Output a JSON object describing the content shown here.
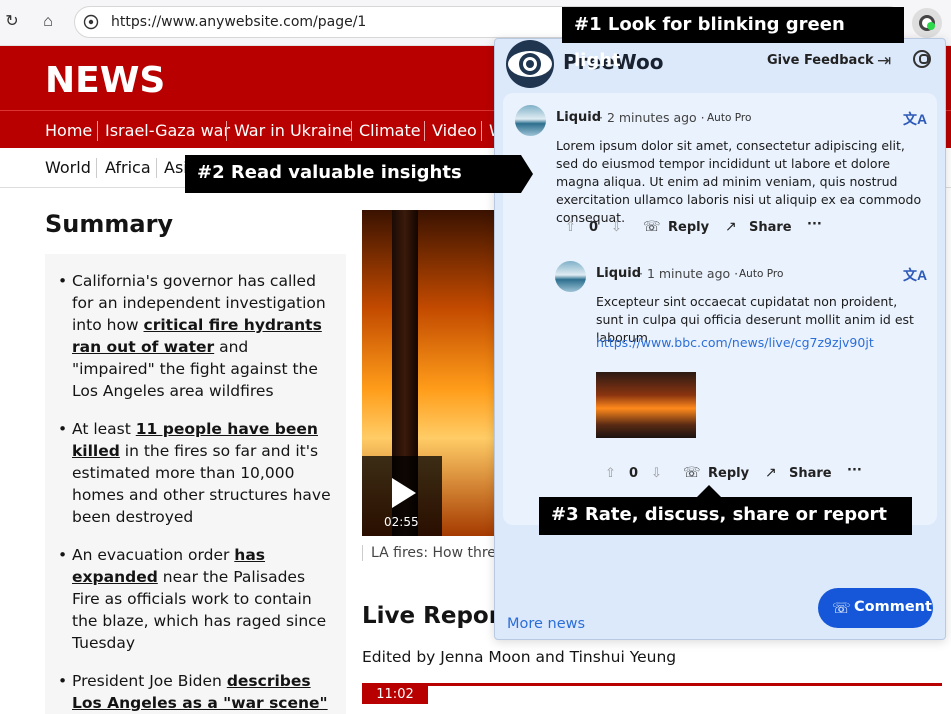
{
  "browser": {
    "url": "https://www.anywebsite.com/page/1"
  },
  "site": {
    "logo": "NEWS",
    "nav": [
      "Home",
      "Israel-Gaza war",
      "War in Ukraine",
      "Climate",
      "Video",
      "W"
    ],
    "subnav": [
      "World",
      "Africa",
      "Asi"
    ]
  },
  "summary": {
    "title": "Summary",
    "bullets": [
      {
        "pre": "California's governor has called for an independent investigation into how ",
        "link": "critical fire hydrants ran out of water",
        "post": " and \"impaired\" the fight against the Los Angeles area wildfires"
      },
      {
        "pre": "At least ",
        "link": "11 people have been killed",
        "post": " in the fires so far and it's estimated more than 10,000 homes and other structures have been destroyed"
      },
      {
        "pre": "An evacuation order ",
        "link": "has expanded",
        "post": " near the Palisades Fire as officials work to contain the blaze, which has raged since Tuesday"
      },
      {
        "pre": "President Joe Biden ",
        "link": "describes Los Angeles as a \"war scene\"",
        "post": ""
      }
    ]
  },
  "video": {
    "duration": "02:55",
    "caption": "LA fires: How three"
  },
  "live": {
    "title": "Live Report",
    "edited": "Edited by Jenna Moon and Tinshui Yeung",
    "time": "11:02"
  },
  "callouts": {
    "one": "#1 Look for blinking green light",
    "two": "#2 Read valuable insights",
    "three": "#3 Rate, discuss, share or report"
  },
  "panel": {
    "brand": "PreeWoo",
    "feedback": "Give Feedback",
    "more_news": "More news",
    "comment_button": "Comment",
    "comments": [
      {
        "user": "Liquid",
        "time": "· 2 minutes ago ·",
        "badge": "Auto Pro",
        "text": "Lorem ipsum dolor sit amet, consectetur adipiscing elit, sed do eiusmod tempor incididunt ut labore et dolore magna aliqua. Ut enim ad minim veniam, quis nostrud exercitation ullamco laboris nisi ut aliquip ex ea commodo consequat.",
        "votes": "0",
        "reply": "Reply",
        "share": "Share"
      },
      {
        "user": "Liquid",
        "time": "· 1 minute ago ·",
        "badge": "Auto Pro",
        "text": "Excepteur sint occaecat cupidatat non proident, sunt in culpa qui officia deserunt mollit anim id est laborum",
        "link": "https://www.bbc.com/news/live/cg7z9zjv90jt",
        "votes": "0",
        "reply": "Reply",
        "share": "Share"
      }
    ]
  },
  "colors": {
    "brand_red": "#b80000",
    "panel_bg": "#dce9fb",
    "accent_blue": "#1557d8",
    "indicator_green": "#2bd94a"
  }
}
